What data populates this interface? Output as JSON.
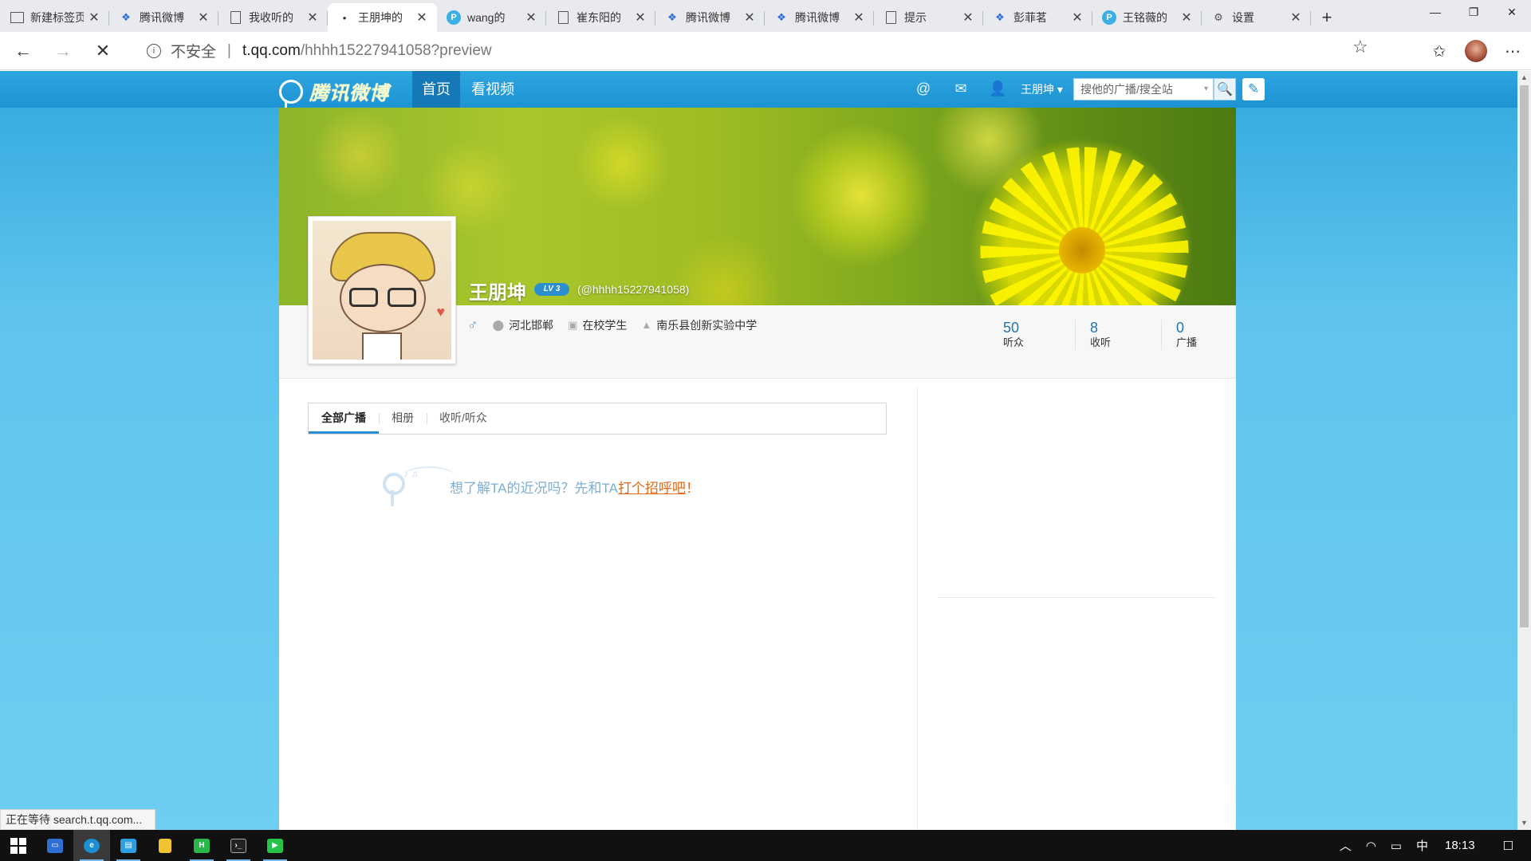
{
  "browser": {
    "tabs": [
      {
        "title": "新建标签页",
        "icon": "news-icon",
        "active": false
      },
      {
        "title": "腾讯微博",
        "icon": "paw-icon",
        "active": false
      },
      {
        "title": "我收听的",
        "icon": "page-icon",
        "active": false
      },
      {
        "title": "王朋坤的",
        "icon": "loading-dot-icon",
        "active": true
      },
      {
        "title": "wang的",
        "icon": "qq-weibo-icon",
        "active": false
      },
      {
        "title": "崔东阳的",
        "icon": "page-icon",
        "active": false
      },
      {
        "title": "腾讯微博",
        "icon": "paw-icon",
        "active": false
      },
      {
        "title": "腾讯微博",
        "icon": "paw-icon",
        "active": false
      },
      {
        "title": "提示",
        "icon": "page-icon",
        "active": false
      },
      {
        "title": "彭菲茗",
        "icon": "paw-icon",
        "active": false
      },
      {
        "title": "王铭薇的",
        "icon": "qq-weibo-icon",
        "active": false
      },
      {
        "title": "设置",
        "icon": "gear-icon",
        "active": false
      }
    ],
    "security_label": "不安全",
    "url_host": "t.qq.com",
    "url_path": "/hhhh15227941058?preview",
    "status_text": "正在等待 search.t.qq.com..."
  },
  "site": {
    "logo_text": "腾讯微博",
    "nav": {
      "home": "首页",
      "video": "看视频"
    },
    "user_menu": "王朋坤 ▾",
    "search_placeholder": "搜他的广播/搜全站",
    "search_caret": "▾"
  },
  "profile": {
    "name": "王朋坤",
    "level_badge": "LV 3",
    "handle": "(@hhhh15227941058)",
    "gender_symbol": "♂",
    "location": "河北邯郸",
    "occupation": "在校学生",
    "school": "南乐县创新实验中学",
    "stats": [
      {
        "value": "50",
        "label": "听众"
      },
      {
        "value": "8",
        "label": "收听"
      },
      {
        "value": "0",
        "label": "广播"
      }
    ]
  },
  "content_tabs": [
    "全部广播",
    "相册",
    "收听/听众"
  ],
  "empty_state": {
    "prefix": "想了解TA的近况吗？先和TA",
    "link": "打个招呼吧",
    "suffix": "！"
  },
  "taskbar": {
    "ime": "中",
    "time": "18:13"
  }
}
